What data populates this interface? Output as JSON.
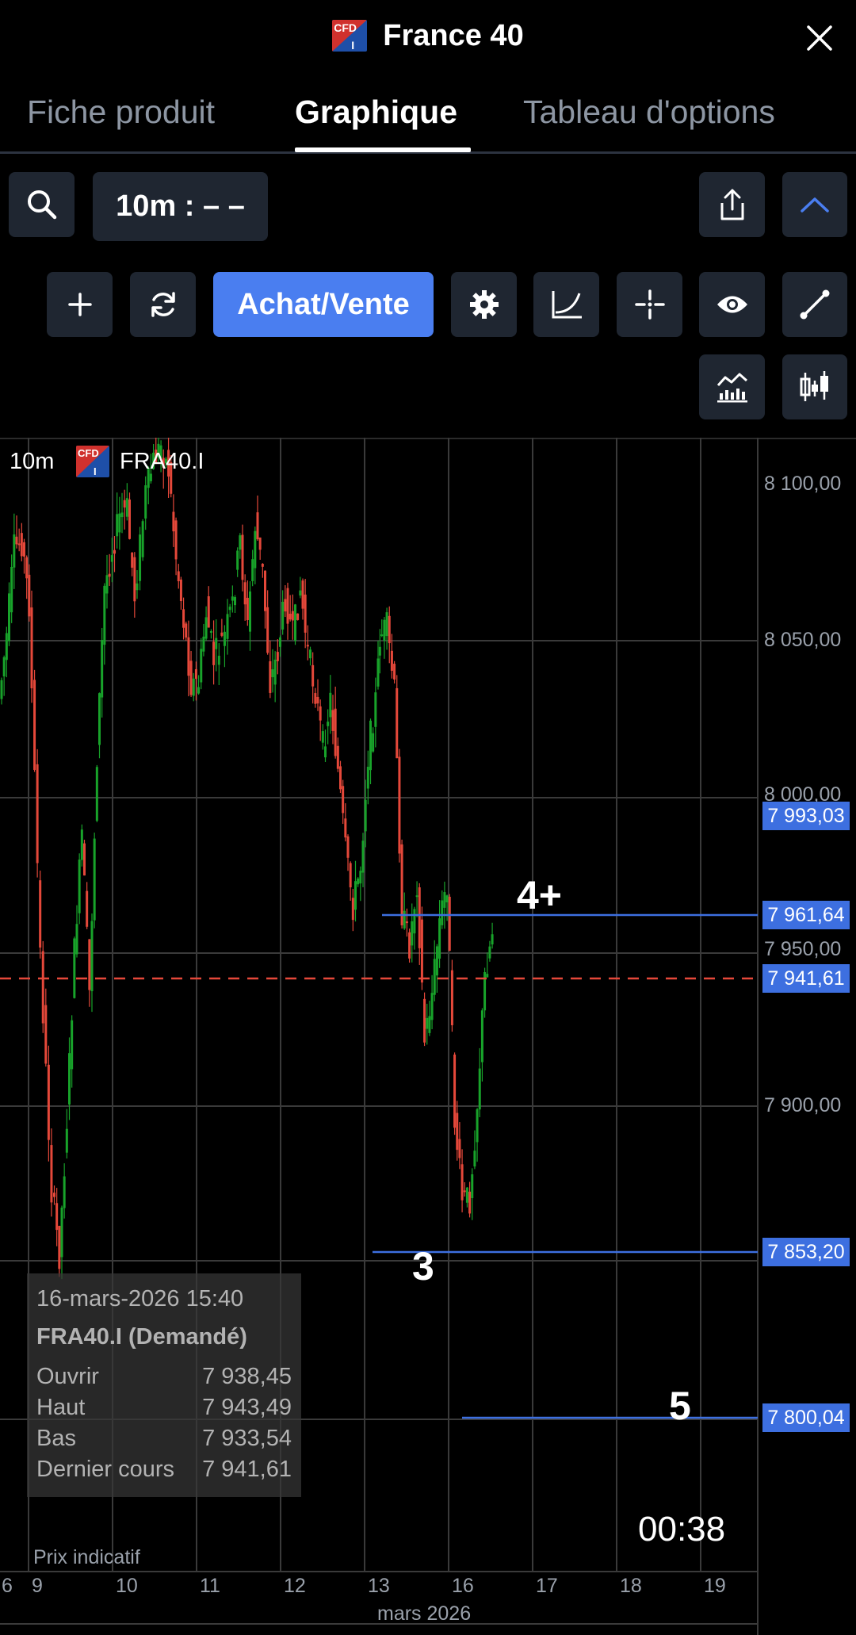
{
  "header": {
    "title": "France 40",
    "logo_text_top": "CFD",
    "logo_text_bottom": "I"
  },
  "tabs": [
    {
      "label": "Fiche produit",
      "active": false
    },
    {
      "label": "Graphique",
      "active": true
    },
    {
      "label": "Tableau d'options",
      "active": false
    }
  ],
  "toolbar": {
    "interval_label": "10m : – –",
    "buy_sell_label": "Achat/Vente"
  },
  "chart": {
    "interval": "10m",
    "symbol": "FRA40.I",
    "y_axis_labels": [
      "8 100,00",
      "8 050,00",
      "8 000,00",
      "7 950,00",
      "7 900,00"
    ],
    "x_axis_labels": [
      "6",
      "9",
      "10",
      "11",
      "12",
      "13",
      "16",
      "17",
      "18",
      "19"
    ],
    "x_axis_title": "mars 2026",
    "current_price": "7 941,61",
    "price_tags": [
      "7 993,03",
      "7 961,64",
      "7 941,61",
      "7 853,20",
      "7 800,04"
    ],
    "annotations": [
      "4+",
      "3",
      "5"
    ],
    "timer": "00:38",
    "indicative_label": "Prix indicatif",
    "colors": {
      "up": "#18a32a",
      "down": "#e5483a",
      "line": "#3d6fe0",
      "dashed": "#e5483a"
    }
  },
  "ohlc": {
    "datetime": "16-mars-2026 15:40",
    "title": "FRA40.I (Demandé)",
    "rows": [
      {
        "label": "Ouvrir",
        "value": "7 938,45"
      },
      {
        "label": "Haut",
        "value": "7 943,49"
      },
      {
        "label": "Bas",
        "value": "7 933,54"
      },
      {
        "label": "Dernier cours",
        "value": "7 941,61"
      }
    ]
  }
}
